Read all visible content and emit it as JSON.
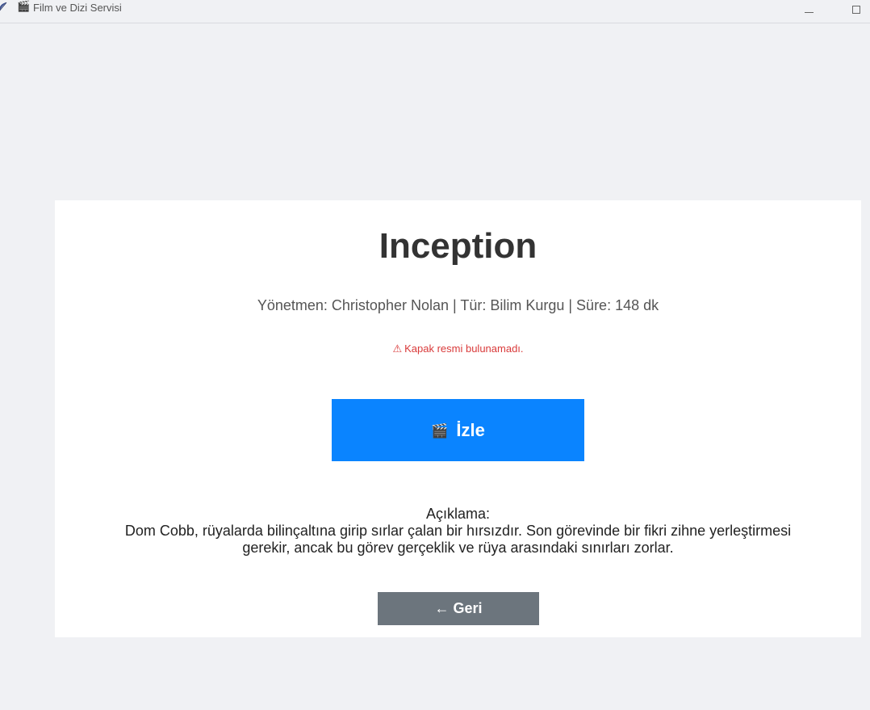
{
  "window": {
    "title_glyph": "🎬",
    "title": "Film ve Dizi Servisi"
  },
  "movie": {
    "title": "Inception",
    "meta": "Yönetmen: Christopher Nolan | Tür: Bilim Kurgu | Süre: 148 dk",
    "warning_icon": "⚠",
    "warning": "Kapak resmi bulunamadı.",
    "description_label": "Açıklama:",
    "description": "Dom Cobb, rüyalarda bilinçaltına girip sırlar çalan bir hırsızdır. Son görevinde bir fikri zihne yerleştirmesi gerekir, ancak bu görev gerçeklik ve rüya arasındaki sınırları zorlar."
  },
  "buttons": {
    "watch_icon": "🎬",
    "watch_label": "İzle",
    "back_label": "← Geri"
  },
  "colors": {
    "primary": "#0a84ff",
    "secondary": "#6c757d",
    "warning": "#d93a3a",
    "background": "#f0f1f4",
    "card": "#ffffff"
  },
  "icons": {
    "app": "feather-icon",
    "title": "clapperboard-icon",
    "warning": "warning-triangle-icon",
    "watch": "clapperboard-icon"
  }
}
